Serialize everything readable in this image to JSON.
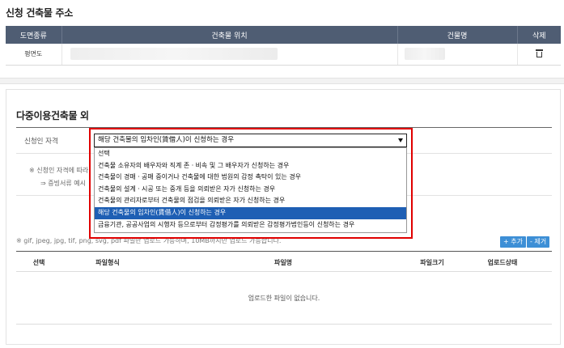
{
  "section_address": {
    "title": "신청 건축물 주소",
    "columns": [
      "도면종류",
      "건축물 위치",
      "건물명",
      "삭제"
    ],
    "rows": [
      {
        "type": "평면도"
      }
    ]
  },
  "section_multi": {
    "title": "다중이용건축물 외",
    "field_label": "신청인 자격",
    "selected_value": "해당 건축물의 임차인(賃借人)이 신청하는 경우",
    "options": [
      "선택",
      "건축물 소유자의 배우자와 직계 존ㆍ비속 및 그 배우자가 신청하는 경우",
      "건축물이 경매ㆍ공매 중이거나 건축물에 대한 법원의 감정 촉탁이 있는 경우",
      "건축물의 설계ㆍ시공 또는 중개 등을 의뢰받은 자가 신청하는 경우",
      "건축물의 관리자로부터 건축물의 점검을 의뢰받은 자가 신청하는 경우",
      "해당 건축물의 임차인(賃借人)이 신청하는 경우",
      "금융기관, 공공사업의 시행자 등으로부터 감정평가를 의뢰받은 감정평가법인등이 신청하는 경우"
    ],
    "selected_index": 5,
    "note_line1": "※ 신청인 자격에 따라",
    "note_line2": "⇒ 증빙서류 예시",
    "upload_hint": "※ gif, jpeg, jpg, tif, png, svg, pdf 파일만 업로드 가능하며, 10MB까지만 업로드 가능합니다.",
    "add_label": "+ 추가",
    "remove_label": "- 제거",
    "file_columns": [
      "선택",
      "파일형식",
      "파일명",
      "파일크기",
      "업로드상태"
    ],
    "empty_text": "업로드한 파일이 없습니다."
  },
  "icons": {
    "delete": "trash-icon",
    "dropdown": "chevron-down-icon"
  },
  "colors": {
    "header_bg": "#4f5d73",
    "highlight_border": "#e00000",
    "selected_option": "#1e5fb4",
    "button": "#3d8fd6"
  }
}
